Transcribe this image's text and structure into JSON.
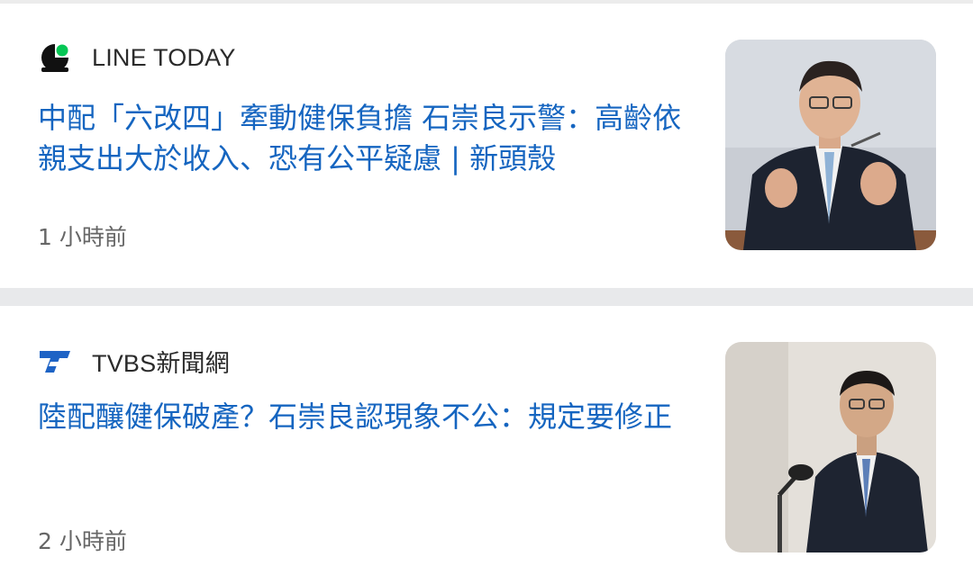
{
  "articles": [
    {
      "source": "LINE TODAY",
      "source_icon": "line-today-logo-icon",
      "headline": "中配「六改四」牽動健保負擔 石崇良示警：高齡依親支出大於收入、恐有公平疑慮 | 新頭殼",
      "time": "1 小時前",
      "thumbnail": "official-speaking-at-podium-photo"
    },
    {
      "source": "TVBS新聞網",
      "source_icon": "tvbs-logo-icon",
      "headline": "陸配釀健保破產？石崇良認現象不公：規定要修正",
      "time": "2 小時前",
      "thumbnail": "official-at-microphone-photo"
    }
  ],
  "colors": {
    "headline": "#1565c0",
    "source_text": "#2b2b2b",
    "time_text": "#666666",
    "separator": "#e8e9eb",
    "line_green": "#06c755",
    "tvbs_blue": "#1e63c5"
  }
}
